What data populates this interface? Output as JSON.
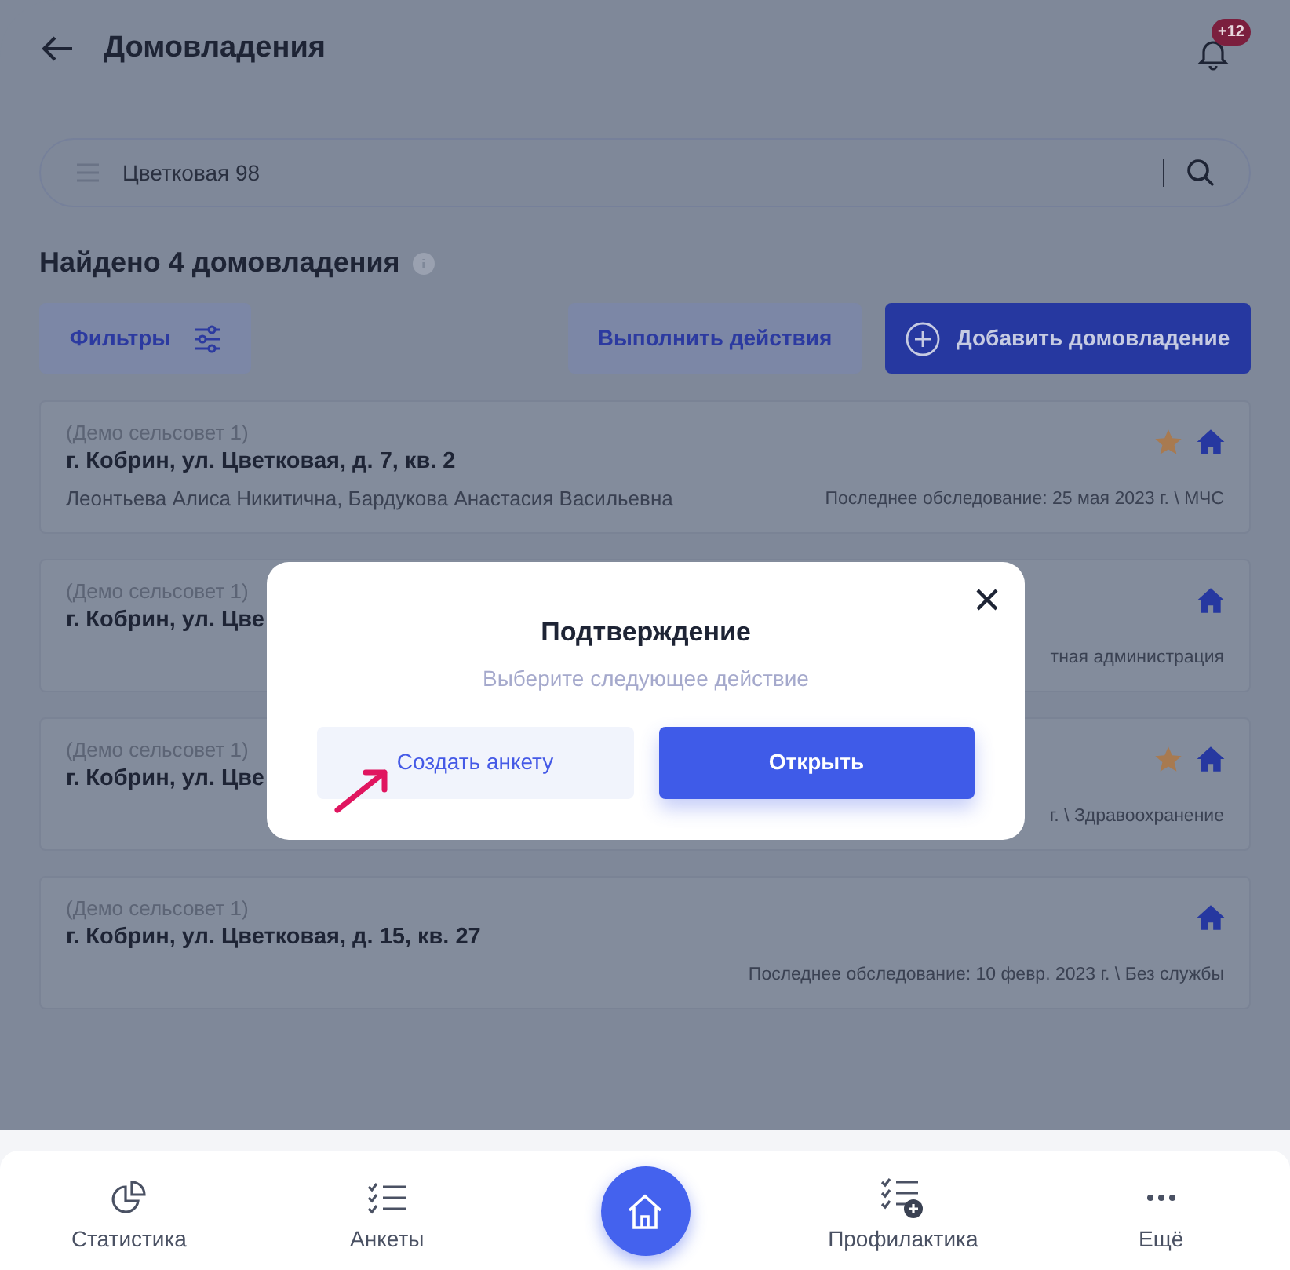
{
  "header": {
    "title": "Домовладения",
    "notification_badge": "+12"
  },
  "search": {
    "value": "Цветковая 98"
  },
  "results_title": "Найдено 4 домовладения",
  "toolbar": {
    "filters": "Фильтры",
    "actions": "Выполнить действия",
    "add": "Добавить домовладение"
  },
  "cards": [
    {
      "district": "(Демо сельсовет 1)",
      "address": "г. Кобрин, ул. Цветковая, д. 7, кв. 2",
      "residents": "Леонтьева Алиса Никитична, Бардукова Анастасия Васильевна",
      "survey": "Последнее обследование: 25 мая 2023 г. \\ МЧС",
      "starred": true
    },
    {
      "district": "(Демо сельсовет 1)",
      "address": "г. Кобрин, ул. Цве",
      "survey": "тная администрация",
      "starred": false
    },
    {
      "district": "(Демо сельсовет 1)",
      "address": "г. Кобрин, ул. Цве",
      "survey": "г. \\ Здравоохранение",
      "starred": true
    },
    {
      "district": "(Демо сельсовет 1)",
      "address": "г. Кобрин, ул. Цветковая, д. 15, кв. 27",
      "survey": "Последнее обследование: 10 февр. 2023 г. \\ Без службы",
      "starred": false
    }
  ],
  "dialog": {
    "title": "Подтверждение",
    "subtitle": "Выберите следующее действие",
    "buttons": [
      {
        "label": "Создать анкету",
        "kind": "secondary"
      },
      {
        "label": "Открыть",
        "kind": "primary"
      }
    ]
  },
  "bottom_nav": [
    {
      "label": "Статистика",
      "kind": "stats"
    },
    {
      "label": "Анкеты",
      "kind": "list"
    },
    {
      "kind": "home"
    },
    {
      "label": "Профилактика",
      "kind": "add-list"
    },
    {
      "label": "Ещё",
      "kind": "more"
    }
  ]
}
